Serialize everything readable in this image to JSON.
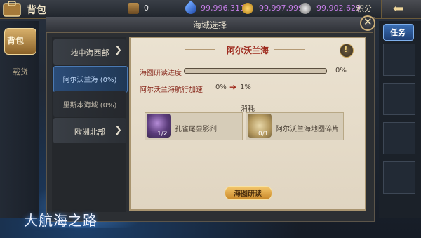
{
  "topbar": {
    "title": "背包",
    "resources": {
      "boxes": "0",
      "gems": "99,996,311",
      "coins": "99,997,999",
      "silver": "99,902,629"
    },
    "points_label": "积分"
  },
  "left_tabs": [
    {
      "label": "背包",
      "selected": true
    },
    {
      "label": "载货",
      "selected": false
    }
  ],
  "right_tab": {
    "label": "任务"
  },
  "dialog": {
    "title": "海域选择",
    "sea_list": [
      {
        "label": "地中海西部",
        "has_arrow": true,
        "state": "group"
      },
      {
        "label": "阿尔沃兰海 (0%)",
        "has_arrow": false,
        "state": "selected"
      },
      {
        "label": "里斯本海域 (0%)",
        "has_arrow": false,
        "state": "normal"
      },
      {
        "label": "欧洲北部",
        "has_arrow": true,
        "state": "group"
      }
    ],
    "panel": {
      "title": "阿尔沃兰海",
      "progress_label": "海图研读进度",
      "progress_value": "0%",
      "progress_fraction": 0.0,
      "speed_label": "阿尔沃兰海航行加速",
      "speed_from": "0%",
      "speed_to": "1%",
      "cost_title": "消耗",
      "costs": [
        {
          "name": "孔雀尾显影剂",
          "qty": "1/2",
          "icon": "potion-icon"
        },
        {
          "name": "阿尔沃兰海地图碎片",
          "qty": "0/1",
          "icon": "map-fragment-icon"
        }
      ],
      "action_label": "海图研读"
    }
  },
  "logo_text": "大航海之路",
  "colors": {
    "accent_gold": "#cdb07a",
    "selected_blue": "#2b4c78",
    "title_red": "#9e2b1f",
    "currency_purple": "#c67fe8"
  }
}
